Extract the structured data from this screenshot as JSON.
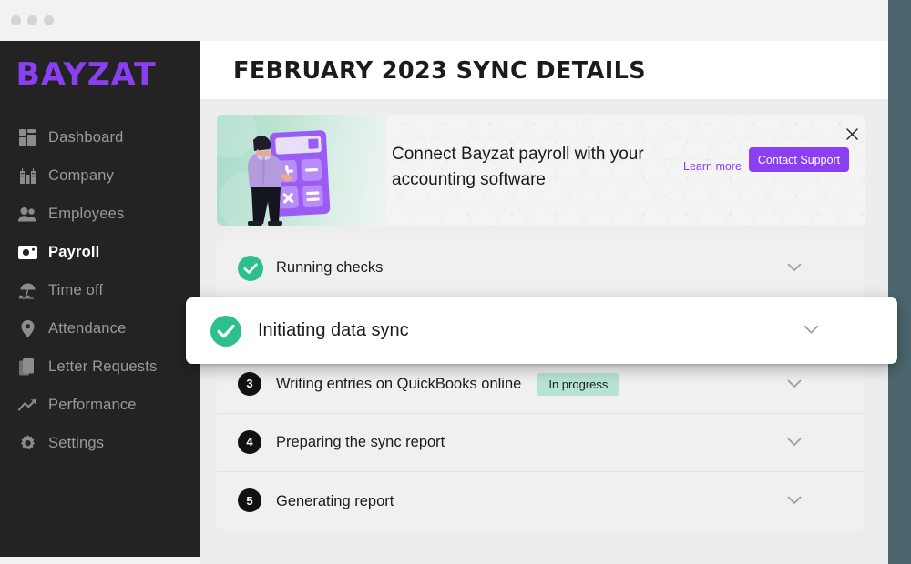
{
  "window": {
    "traffic_lights": [
      "close",
      "minimize",
      "maximize"
    ]
  },
  "sidebar": {
    "logo": "BAYZAT",
    "items": [
      {
        "label": "Dashboard",
        "icon": "dashboard-grid-icon",
        "active": false
      },
      {
        "label": "Company",
        "icon": "buildings-icon",
        "active": false
      },
      {
        "label": "Employees",
        "icon": "people-icon",
        "active": false
      },
      {
        "label": "Payroll",
        "icon": "banknote-icon",
        "active": true
      },
      {
        "label": "Time off",
        "icon": "beach-umbrella-icon",
        "active": false
      },
      {
        "label": "Attendance",
        "icon": "location-pin-icon",
        "active": false
      },
      {
        "label": "Letter Requests",
        "icon": "documents-icon",
        "active": false
      },
      {
        "label": "Performance",
        "icon": "trending-up-icon",
        "active": false
      },
      {
        "label": "Settings",
        "icon": "gear-icon",
        "active": false
      }
    ]
  },
  "header": {
    "title": "FEBRUARY 2023 SYNC DETAILS"
  },
  "banner": {
    "headline": "Connect Bayzat payroll with your accounting software",
    "learn_more_label": "Learn more",
    "contact_support_label": "Contact Support",
    "close_icon": "close-icon",
    "illustration": "person-with-calculator-illustration",
    "accent_color": "#8a3ff2"
  },
  "steps": [
    {
      "label": "Running checks",
      "state": "complete",
      "marker": "check-circle-icon",
      "badge": null
    },
    {
      "label": "Initiating data sync",
      "state": "complete",
      "marker": "check-circle-icon",
      "badge": null,
      "highlighted": true
    },
    {
      "label": "Writing entries on QuickBooks online",
      "state": "in-progress",
      "marker": "3",
      "badge": "In progress"
    },
    {
      "label": "Preparing the sync report",
      "state": "pending",
      "marker": "4",
      "badge": null
    },
    {
      "label": "Generating report",
      "state": "pending",
      "marker": "5",
      "badge": null
    }
  ],
  "colors": {
    "brand_purple": "#8a3ff2",
    "success_green": "#2ec08a",
    "badge_mint": "#b6e3d3",
    "sidebar_dark": "#232323",
    "page_backdrop": "#4c666f"
  }
}
